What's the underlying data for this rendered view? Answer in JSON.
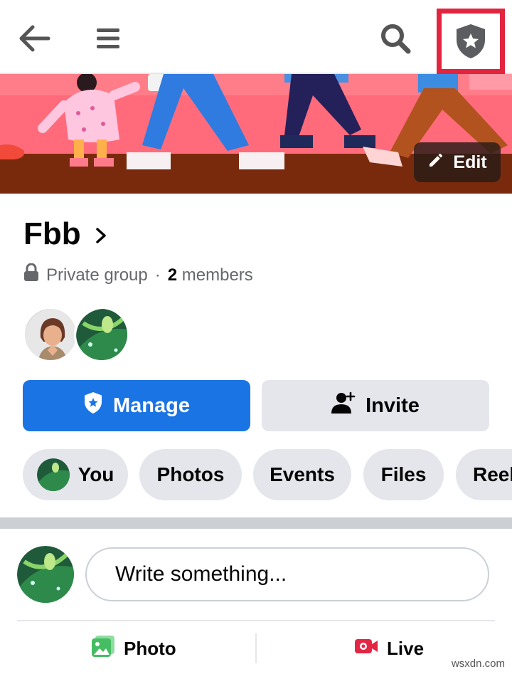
{
  "topbar": {
    "icons": [
      "back-arrow-icon",
      "menu-icon",
      "search-icon",
      "admin-shield-icon"
    ]
  },
  "cover": {
    "edit_label": "Edit"
  },
  "group": {
    "name": "Fbb",
    "privacy": "Private group",
    "separator": "·",
    "member_count": "2",
    "members_label": "members"
  },
  "actions": {
    "manage_label": "Manage",
    "invite_label": "Invite"
  },
  "tabs": [
    {
      "label": "You"
    },
    {
      "label": "Photos"
    },
    {
      "label": "Events"
    },
    {
      "label": "Files"
    },
    {
      "label": "Reel"
    }
  ],
  "composer": {
    "placeholder": "Write something...",
    "photo_label": "Photo",
    "live_label": "Live"
  },
  "colors": {
    "primary": "#1b74e4",
    "highlight": "#e3243f",
    "photo_icon": "#45bd62",
    "live_icon": "#e42645"
  },
  "watermark": "wsxdn.com"
}
